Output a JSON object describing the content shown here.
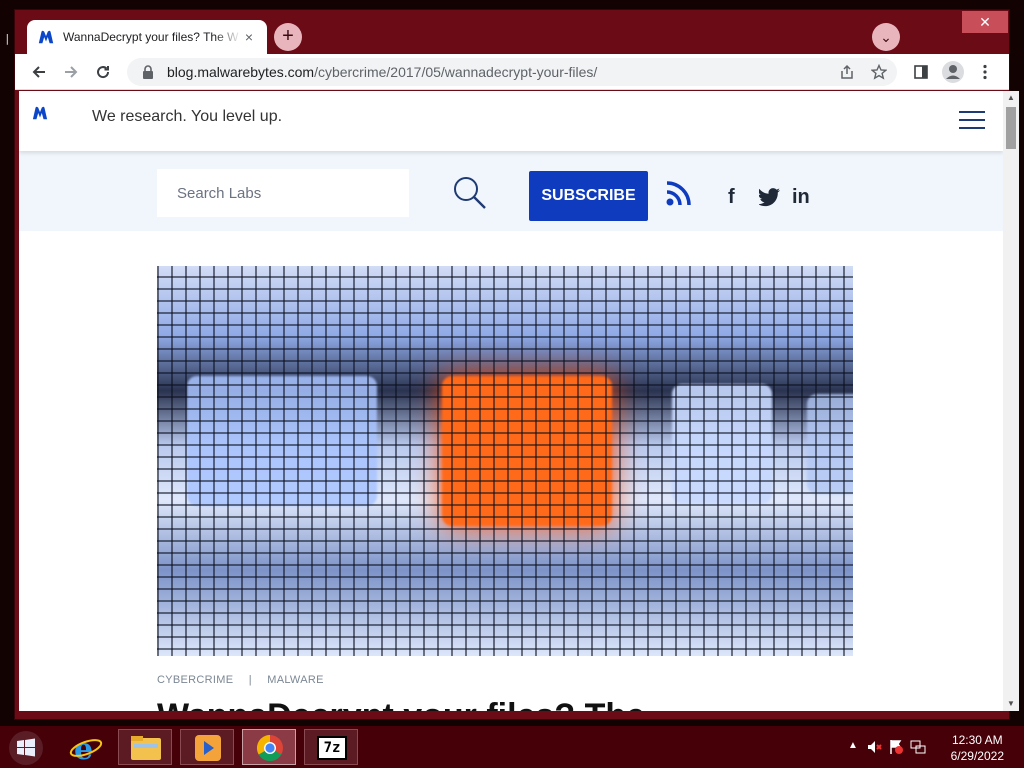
{
  "browser": {
    "tab": {
      "title": "WannaDecrypt your files? The W",
      "close": "×"
    },
    "new_tab": "+",
    "tab_search": "⌄",
    "window_close": "✕",
    "url": {
      "host": "blog.malwarebytes.com",
      "path": "/cybercrime/2017/05/wannadecrypt-your-files/"
    }
  },
  "site": {
    "tagline": "We research. You level up.",
    "search": {
      "placeholder": "Search Labs"
    },
    "subscribe_label": "SUBSCRIBE",
    "social": [
      "f",
      "twitter",
      "in"
    ],
    "categories": [
      "CYBERCRIME",
      "|",
      "MALWARE"
    ],
    "headline": "WannaDecrypt your files? The",
    "accent_color": "#0f3bbf"
  },
  "taskbar": {
    "apps": [
      "internet-explorer",
      "file-explorer",
      "media-player",
      "chrome",
      "7-zip"
    ],
    "seven_zip_label": "7z",
    "clock": {
      "time": "12:30 AM",
      "date": "6/29/2022"
    }
  }
}
